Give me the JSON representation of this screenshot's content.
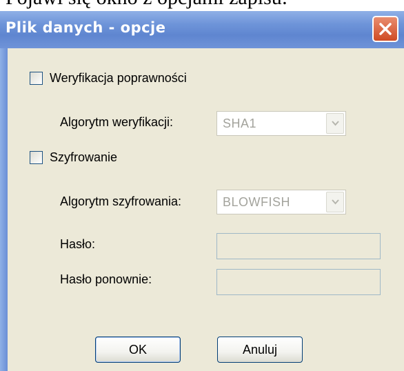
{
  "caption": "Pojawi się okno z opcjami zapisu:",
  "window": {
    "title": "Plik danych - opcje",
    "close_icon": "close-x-icon"
  },
  "verification": {
    "checkbox_label": "Weryfikacja poprawności",
    "checked": false,
    "algorithm_label": "Algorytm weryfikacji:",
    "algorithm_value": "SHA1"
  },
  "encryption": {
    "checkbox_label": "Szyfrowanie",
    "checked": false,
    "algorithm_label": "Algorytm szyfrowania:",
    "algorithm_value": "BLOWFISH",
    "password_label": "Hasło:",
    "password_value": "",
    "password_repeat_label": "Hasło ponownie:",
    "password_repeat_value": ""
  },
  "buttons": {
    "ok_label": "OK",
    "cancel_label": "Anuluj"
  },
  "colors": {
    "titlebar": "#6e94d9",
    "dialog_bg": "#ece9d8",
    "close_button": "#d9582f",
    "disabled_text": "#a3a39c"
  }
}
